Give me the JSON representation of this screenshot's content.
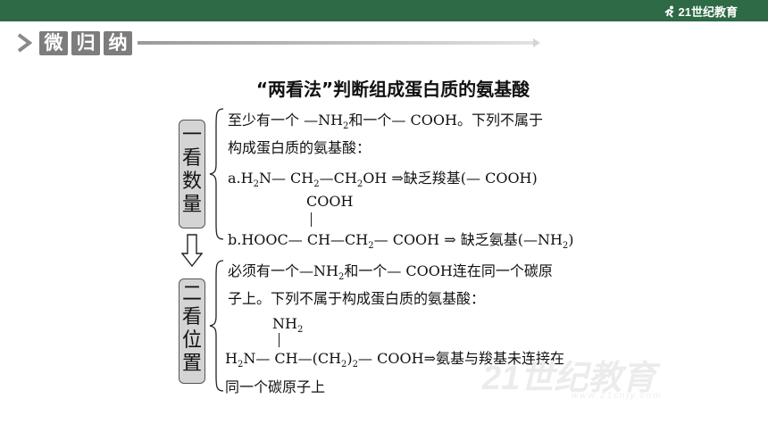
{
  "header": {
    "logo_text": "21世纪教育"
  },
  "section": {
    "c1": "微",
    "c2": "归",
    "c3": "纳"
  },
  "title": "“两看法”判断组成蛋白质的氨基酸",
  "box1": {
    "c1": "一",
    "c2": "看",
    "c3": "数",
    "c4": "量"
  },
  "box2": {
    "c1": "二",
    "c2": "看",
    "c3": "位",
    "c4": "置"
  },
  "part1": {
    "l1_a": "至少有一个 —NH",
    "l1_sub": "2",
    "l1_b": "和一个— COOH。下列不属于",
    "l2": "构成蛋白质的氨基酸：",
    "a_pre": "a.H",
    "a_s1": "2",
    "a_m1": "N— CH",
    "a_s2": "2",
    "a_m2": "—CH",
    "a_s3": "2",
    "a_m3": "OH ⇒缺乏羧基(— COOH)",
    "b_top": "COOH",
    "b_pre": "b.HOOC— CH—CH",
    "b_s1": "2",
    "b_m1": "— COOH  ⇒ 缺乏氨基(—NH",
    "b_s2": "2",
    "b_end": ")"
  },
  "part2": {
    "l1_a": "必须有一个—NH",
    "l1_sub": "2",
    "l1_b": "和一个— COOH连在同一个碳原",
    "l2": "子上。下列不属于构成蛋白质的氨基酸：",
    "c_top": "NH",
    "c_top_sub": "2",
    "c_pre": "H",
    "c_s1": "2",
    "c_m1": "N— CH—(CH",
    "c_s2": "2",
    "c_m2": ")",
    "c_s3": "2",
    "c_m3": "— COOH⇒氨基与羧基未连接在",
    "l4": "同一个碳原子上"
  },
  "watermark": {
    "text": "21世纪教育",
    "url": "www.21cnjy.com"
  }
}
